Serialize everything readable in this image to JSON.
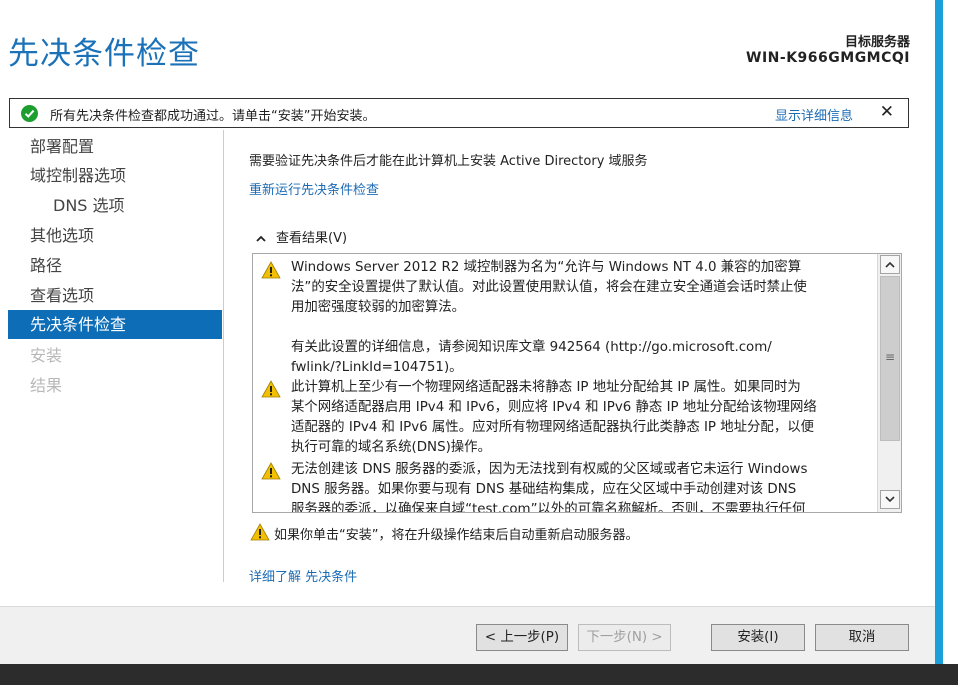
{
  "page": {
    "title": "先决条件检查",
    "target_server_label": "目标服务器",
    "target_server_name": "WIN-K966GMGMCQI"
  },
  "notification": {
    "message": "所有先决条件检查都成功通过。请单击“安装”开始安装。",
    "detail_link": "显示详细信息",
    "close_glyph": "✕",
    "status_color": "#1e9e2e"
  },
  "sidebar": {
    "items": [
      {
        "label": "部署配置",
        "state": "normal"
      },
      {
        "label": "域控制器选项",
        "state": "normal"
      },
      {
        "label": "DNS 选项",
        "state": "indent"
      },
      {
        "label": "其他选项",
        "state": "normal"
      },
      {
        "label": "路径",
        "state": "normal"
      },
      {
        "label": "查看选项",
        "state": "normal"
      },
      {
        "label": "先决条件检查",
        "state": "active"
      },
      {
        "label": "安装",
        "state": "disabled"
      },
      {
        "label": "结果",
        "state": "disabled"
      }
    ],
    "active_color": "#0e6db7"
  },
  "main": {
    "intro": "需要验证先决条件后才能在此计算机上安装 Active Directory 域服务",
    "rerun_link": "重新运行先决条件检查",
    "results_header": "查看结果(V)",
    "results": [
      {
        "icon": "warning-icon",
        "lines": [
          "Windows Server 2012 R2 域控制器为名为“允许与 Windows NT 4.0 兼容的加密算",
          "法”的安全设置提供了默认值。对此设置使用默认值，将会在建立安全通道会话时禁止使",
          "用加密强度较弱的加密算法。",
          "",
          "有关此设置的详细信息，请参阅知识库文章 942564 (http://go.microsoft.com/",
          "fwlink/?LinkId=104751)。"
        ]
      },
      {
        "icon": "warning-icon",
        "lines": [
          "此计算机上至少有一个物理网络适配器未将静态 IP 地址分配给其 IP 属性。如果同时为",
          "某个网络适配器启用 IPv4 和 IPv6，则应将 IPv4 和 IPv6 静态 IP 地址分配给该物理网络",
          "适配器的 IPv4 和 IPv6 属性。应对所有物理网络适配器执行此类静态 IP 地址分配，以便",
          "执行可靠的域名系统(DNS)操作。"
        ]
      },
      {
        "icon": "warning-icon",
        "lines": [
          "无法创建该 DNS 服务器的委派，因为无法找到有权威的父区域或者它未运行 Windows",
          "DNS 服务器。如果你要与现有 DNS 基础结构集成，应在父区域中手动创建对该 DNS",
          "服务器的委派，以确保来自域“test.com”以外的可靠名称解析。否则，不需要执行任何"
        ]
      }
    ],
    "restart_note": "如果你单击“安装”，将在升级操作结束后自动重新启动服务器。",
    "learn_more_link": "详细了解 先决条件"
  },
  "scrollbar": {
    "up_glyph": "⌃",
    "down_glyph": "⌄",
    "grip_glyph": "≡"
  },
  "footer": {
    "back_label": "< 上一步(P)",
    "next_label": "下一步(N) >",
    "install_label": "安装(I)",
    "cancel_label": "取消"
  }
}
